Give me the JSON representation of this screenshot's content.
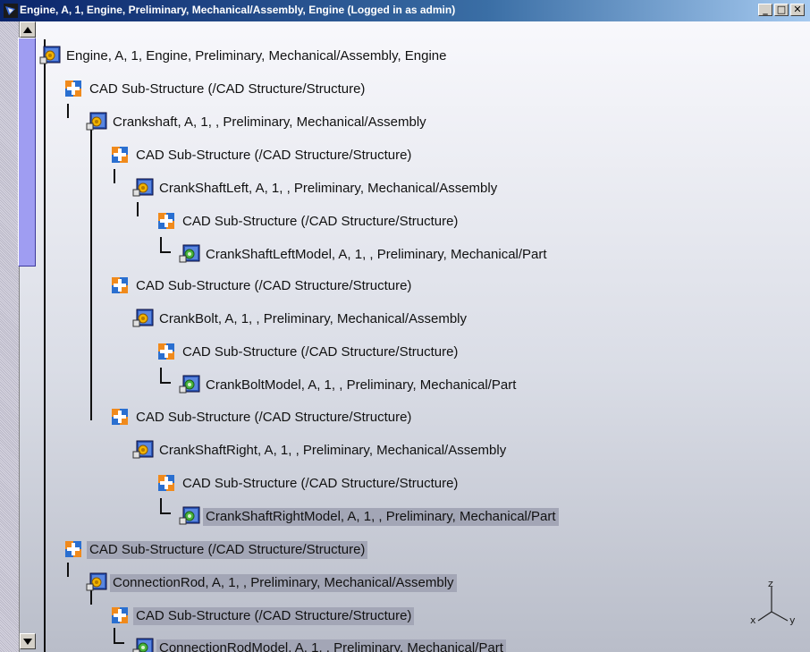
{
  "window": {
    "title": "Engine, A, 1, Engine, Preliminary, Mechanical/Assembly, Engine (Logged in as admin)",
    "buttons": {
      "minimize": "_",
      "maximize": "□",
      "close": "✕"
    }
  },
  "tree": {
    "nodes": [
      {
        "label": "Engine, A, 1, Engine, Preliminary, Mechanical/Assembly, Engine",
        "icon": "assembly-icon"
      },
      {
        "label": "CAD Sub-Structure (/CAD Structure/Structure)",
        "icon": "substructure-icon"
      },
      {
        "label": "Crankshaft, A, 1, , Preliminary, Mechanical/Assembly",
        "icon": "assembly-icon"
      },
      {
        "label": "CAD Sub-Structure (/CAD Structure/Structure)",
        "icon": "substructure-icon"
      },
      {
        "label": "CrankShaftLeft, A, 1, , Preliminary, Mechanical/Assembly",
        "icon": "assembly-icon"
      },
      {
        "label": "CAD Sub-Structure (/CAD Structure/Structure)",
        "icon": "substructure-icon"
      },
      {
        "label": "CrankShaftLeftModel, A, 1, , Preliminary, Mechanical/Part",
        "icon": "part-icon"
      },
      {
        "label": "CAD Sub-Structure (/CAD Structure/Structure)",
        "icon": "substructure-icon"
      },
      {
        "label": "CrankBolt, A, 1, , Preliminary, Mechanical/Assembly",
        "icon": "assembly-icon"
      },
      {
        "label": "CAD Sub-Structure (/CAD Structure/Structure)",
        "icon": "substructure-icon"
      },
      {
        "label": "CrankBoltModel, A, 1, , Preliminary, Mechanical/Part",
        "icon": "part-icon"
      },
      {
        "label": "CAD Sub-Structure (/CAD Structure/Structure)",
        "icon": "substructure-icon"
      },
      {
        "label": "CrankShaftRight, A, 1, , Preliminary, Mechanical/Assembly",
        "icon": "assembly-icon"
      },
      {
        "label": "CAD Sub-Structure (/CAD Structure/Structure)",
        "icon": "substructure-icon"
      },
      {
        "label": "CrankShaftRightModel, A, 1, , Preliminary, Mechanical/Part",
        "icon": "part-icon"
      },
      {
        "label": "CAD Sub-Structure (/CAD Structure/Structure)",
        "icon": "substructure-icon"
      },
      {
        "label": "ConnectionRod, A, 1, , Preliminary, Mechanical/Assembly",
        "icon": "assembly-icon"
      },
      {
        "label": "CAD Sub-Structure (/CAD Structure/Structure)",
        "icon": "substructure-icon"
      },
      {
        "label": "ConnectionRodModel, A, 1, , Preliminary, Mechanical/Part",
        "icon": "part-icon"
      }
    ]
  },
  "compass": {
    "axis_labels": [
      "z",
      "x",
      "y"
    ]
  }
}
